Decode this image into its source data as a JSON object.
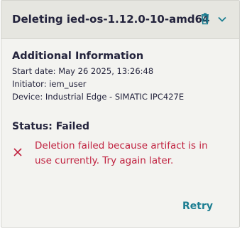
{
  "header": {
    "title": "Deleting ied-os-1.12.0-10-amd64",
    "delete_icon": "trash-icon",
    "expand_icon": "chevron-down-icon"
  },
  "info": {
    "heading": "Additional Information",
    "start_date": "Start date: May 26 2025, 13:26:48",
    "initiator": "Initiator: iem_user",
    "device": "Device: Industrial Edge - SIMATIC IPC427E"
  },
  "status": {
    "label": "Status: Failed",
    "error_icon": "close-icon",
    "error_message": "Deletion failed because artifact is in use currently. Try again later."
  },
  "actions": {
    "retry_label": "Retry"
  },
  "colors": {
    "header_bg": "#e6e6e0",
    "card_bg": "#f3f3f0",
    "icon_accent": "#1b7d91",
    "error": "#c0213f",
    "text": "#23233c"
  }
}
